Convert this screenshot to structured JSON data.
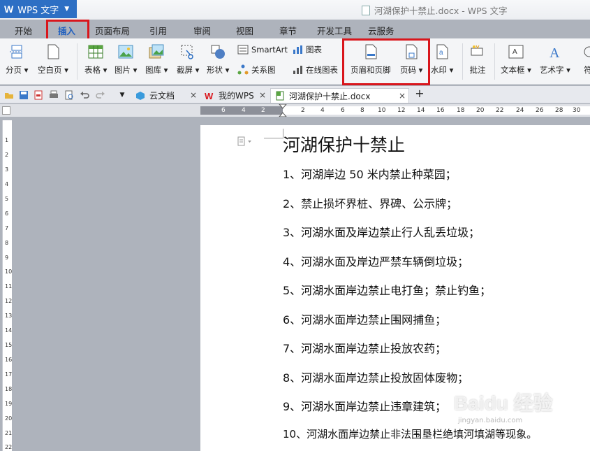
{
  "app": {
    "name": "WPS 文字",
    "window_title": "河湖保护十禁止.docx - WPS 文字"
  },
  "ribbon_tabs": [
    "开始",
    "插入",
    "页面布局",
    "引用",
    "审阅",
    "视图",
    "章节",
    "开发工具",
    "云服务"
  ],
  "ribbon": {
    "fenye": "分页",
    "kongbaiye": "空白页",
    "biaoge": "表格",
    "tupian": "图片",
    "tuku": "图库",
    "jietu": "截屏",
    "xingzhuang": "形状",
    "smartart": "SmartArt",
    "tubiao": "图表",
    "guanxitu": "关系图",
    "zaixiantubiao": "在线图表",
    "yemeiheyejiao": "页眉和页脚",
    "yema": "页码",
    "shuiyin": "水印",
    "pizhu": "批注",
    "wenbenkuang": "文本框",
    "yishuzi": "艺术字",
    "fu": "符"
  },
  "doc_tabs": [
    {
      "label": "云文档"
    },
    {
      "label": "我的WPS"
    },
    {
      "label": "河湖保护十禁止.docx"
    }
  ],
  "ruler": {
    "h": [
      "6",
      "4",
      "2",
      "2",
      "4",
      "6",
      "8",
      "10",
      "12",
      "14",
      "16",
      "18",
      "20",
      "22",
      "24",
      "26",
      "28",
      "30"
    ],
    "v": [
      "1",
      "2",
      "3",
      "4",
      "5",
      "6",
      "7",
      "8",
      "9",
      "10",
      "11",
      "12",
      "13",
      "14",
      "15",
      "16",
      "17",
      "18",
      "19",
      "20",
      "21",
      "22"
    ]
  },
  "document": {
    "heading": "河湖保护十禁止",
    "lines": [
      "1、河湖岸边 50 米内禁止种菜园；",
      "2、禁止损坏界桩、界碑、公示牌；",
      "3、河湖水面及岸边禁止行人乱丢垃圾；",
      "4、河湖水面及岸边严禁车辆倒垃圾；",
      "5、河湖水面岸边禁止电打鱼；禁止钓鱼；",
      "6、河湖水面岸边禁止围网捕鱼；",
      "7、河湖水面岸边禁止投放农药；",
      "8、河湖水面岸边禁止投放固体废物；",
      "9、河湖水面岸边禁止违章建筑；",
      "10、河湖水面岸边禁止非法围垦栏绝填河填湖等现象。"
    ]
  },
  "watermark": {
    "main": "Baidu 经验",
    "sub": "jingyan.baidu.com"
  },
  "colors": {
    "wps_blue": "#2d6fc4",
    "highlight_red": "#d9161c",
    "active_tab": "#1f5fbf"
  }
}
